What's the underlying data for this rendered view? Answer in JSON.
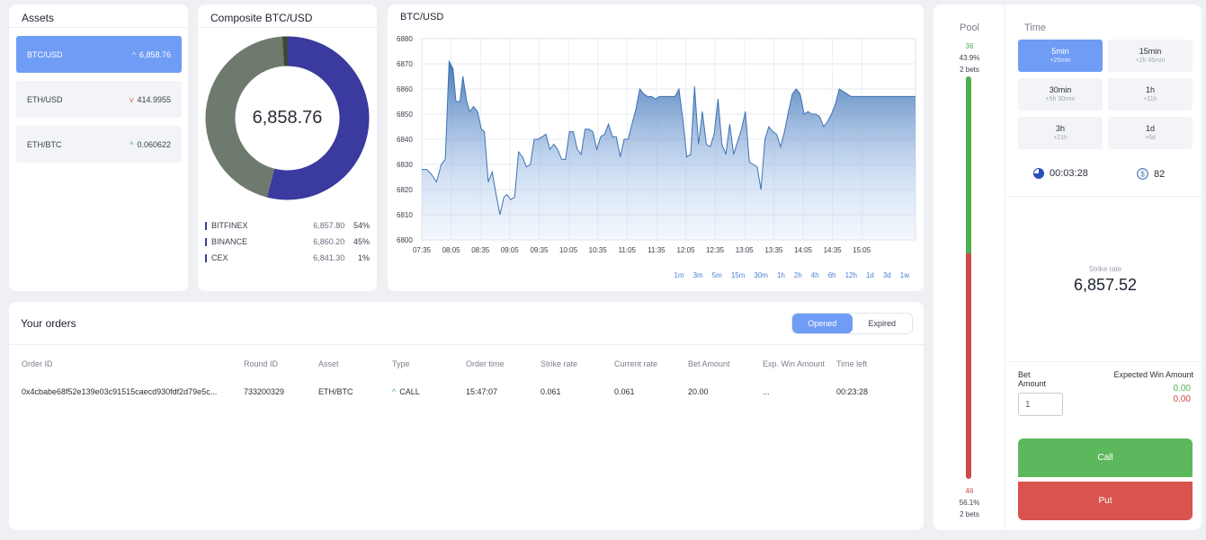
{
  "assets": {
    "title": "Assets",
    "items": [
      {
        "name": "BTC/USD",
        "value": "6,858.76",
        "dir": "up"
      },
      {
        "name": "ETH/USD",
        "value": "414.9955",
        "dir": "down"
      },
      {
        "name": "ETH/BTC",
        "value": "0.060622",
        "dir": "up"
      }
    ]
  },
  "composite": {
    "title": "Composite BTC/USD",
    "value": "6,858.76",
    "exchanges": [
      {
        "name": "BITFINEX",
        "price": "6,857.80",
        "pct": "54%"
      },
      {
        "name": "BINANCE",
        "price": "6,860.20",
        "pct": "45%"
      },
      {
        "name": "CEX",
        "price": "6,841.30",
        "pct": "1%"
      }
    ],
    "colors": [
      "#3b3a9e",
      "#6f7a6e",
      "#3e4a2e"
    ]
  },
  "chart_data": {
    "type": "area",
    "title": "BTC/USD",
    "xlabel": "",
    "ylabel": "",
    "ylim": [
      6800,
      6880
    ],
    "yticks": [
      6800,
      6810,
      6820,
      6830,
      6840,
      6850,
      6860,
      6870,
      6880
    ],
    "xticks": [
      "07:35",
      "08:05",
      "08:35",
      "09:05",
      "09:35",
      "10:05",
      "10:35",
      "11:05",
      "11:35",
      "12:05",
      "12:35",
      "13:05",
      "13:35",
      "14:05",
      "14:35",
      "15:05"
    ],
    "xrange_minutes": [
      455,
      960
    ],
    "grid": true,
    "color": "#3d72b4",
    "series": [
      {
        "x": [
          455,
          460,
          465,
          470,
          475,
          479,
          483,
          487,
          490,
          494,
          497,
          501,
          504,
          508,
          512,
          516,
          519,
          523,
          527,
          531,
          535,
          539,
          542,
          546,
          550,
          554,
          558,
          562,
          566,
          570,
          574,
          578,
          582,
          586,
          590,
          594,
          598,
          602,
          606,
          610,
          614,
          618,
          622,
          626,
          630,
          634,
          638,
          642,
          646,
          650,
          654,
          658,
          662,
          666,
          670,
          674,
          678,
          682,
          686,
          690,
          694,
          698,
          702,
          706,
          710,
          714,
          718,
          722,
          726,
          730,
          734,
          738,
          742,
          746,
          750,
          754,
          758,
          762,
          766,
          770,
          774,
          778,
          782,
          786,
          790,
          794,
          798,
          802,
          806,
          810,
          814,
          818,
          822,
          826,
          830,
          834,
          838,
          842,
          846,
          850,
          854,
          858,
          862,
          866,
          870,
          874,
          878,
          882,
          886,
          890,
          894,
          898,
          902,
          906,
          910,
          914,
          918,
          922,
          926,
          930,
          934,
          938,
          942,
          946,
          950,
          954,
          958,
          960
        ],
        "y": [
          6828,
          6828,
          6826,
          6823,
          6830,
          6832,
          6871,
          6868,
          6855,
          6855,
          6865,
          6855,
          6851,
          6853,
          6851,
          6844,
          6843,
          6823,
          6827,
          6818,
          6810,
          6817,
          6818,
          6816,
          6817,
          6835,
          6833,
          6829,
          6830,
          6840,
          6840,
          6841,
          6842,
          6836,
          6838,
          6836,
          6832,
          6832,
          6843,
          6843,
          6836,
          6834,
          6844,
          6844,
          6843,
          6836,
          6841,
          6842,
          6846,
          6841,
          6841,
          6833,
          6840,
          6840,
          6846,
          6852,
          6860,
          6858,
          6857,
          6857,
          6856,
          6857,
          6857,
          6857,
          6857,
          6857,
          6860,
          6848,
          6833,
          6834,
          6861,
          6838,
          6851,
          6838,
          6837,
          6842,
          6856,
          6838,
          6834,
          6846,
          6834,
          6839,
          6844,
          6851,
          6831,
          6830,
          6829,
          6820,
          6840,
          6845,
          6843,
          6842,
          6837,
          6843,
          6851,
          6858,
          6860,
          6858,
          6850,
          6851,
          6850,
          6850,
          6849,
          6845,
          6847,
          6850,
          6854,
          6860,
          6859,
          6858,
          6857,
          6857,
          6857,
          6857,
          6857,
          6857,
          6857,
          6857,
          6857,
          6857,
          6857,
          6857,
          6857,
          6857,
          6857,
          6857,
          6857,
          6857
        ]
      }
    ]
  },
  "timeframes": [
    "1m",
    "3m",
    "5m",
    "15m",
    "30m",
    "1h",
    "2h",
    "4h",
    "6h",
    "12h",
    "1d",
    "3d",
    "1w"
  ],
  "orders": {
    "title": "Your orders",
    "tabs": {
      "opened": "Opened",
      "expired": "Expired"
    },
    "columns": [
      "Order ID",
      "Round ID",
      "Asset",
      "Type",
      "Order time",
      "Strike rate",
      "Current rate",
      "Bet Amount",
      "Exp. Win Amount",
      "Time left"
    ],
    "rows": [
      [
        "0x4cbabe68f52e139e03c91515caecd930fdf2d79e5c...",
        "733200329",
        "ETH/BTC",
        "CALL",
        "15:47:07",
        "0.061",
        "0.061",
        "20.00",
        "...",
        "00:23:28"
      ]
    ]
  },
  "panel": {
    "pool_title": "Pool",
    "call_count": "36",
    "call_pct": "43.9%",
    "call_bets": "2 bets",
    "put_count": "46",
    "put_pct": "56.1%",
    "put_bets": "2 bets",
    "call_fraction": 0.439,
    "time_title": "Time",
    "time_options": [
      {
        "label": "5min",
        "sub": "+25min"
      },
      {
        "label": "15min",
        "sub": "+2h 45min"
      },
      {
        "label": "30min",
        "sub": "+5h 30min"
      },
      {
        "label": "1h",
        "sub": "+11h"
      },
      {
        "label": "3h",
        "sub": "+21h"
      },
      {
        "label": "1d",
        "sub": "+6d"
      }
    ],
    "timer": "00:03:28",
    "coins": "82",
    "strike_label": "Strike rate",
    "strike_value": "6,857.52",
    "bet_label": "Bet Amount",
    "bet_value": "1",
    "ewa_label": "Expected Win Amount",
    "ewa_call": "0.00",
    "ewa_put": "0.00",
    "call_label": "Call",
    "put_label": "Put"
  }
}
